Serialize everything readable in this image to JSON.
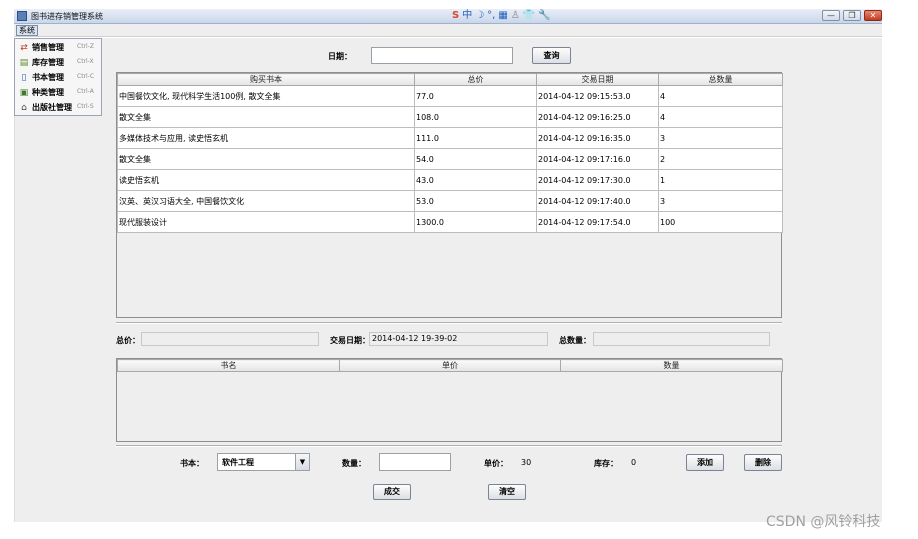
{
  "window": {
    "title": "图书进存销管理系统",
    "ime_icons": [
      "S",
      "中",
      "☽",
      "°,",
      "▦",
      "♙",
      "👕",
      "🔧"
    ],
    "min_label": "—",
    "max_label": "❐",
    "close_label": "✕"
  },
  "menubar": {
    "system": "系统"
  },
  "menu": {
    "items": [
      {
        "label": "销售管理",
        "shortcut": "Ctrl-Z",
        "icon": "sales-icon"
      },
      {
        "label": "库存管理",
        "shortcut": "Ctrl-X",
        "icon": "inventory-icon"
      },
      {
        "label": "书本管理",
        "shortcut": "Ctrl-C",
        "icon": "book-icon"
      },
      {
        "label": "种类管理",
        "shortcut": "Ctrl-A",
        "icon": "category-icon"
      },
      {
        "label": "出版社管理",
        "shortcut": "Ctrl-S",
        "icon": "publisher-icon"
      }
    ]
  },
  "search": {
    "date_label": "日期：",
    "date_value": "",
    "query_button": "查询"
  },
  "orders": {
    "columns": [
      "购买书本",
      "总价",
      "交易日期",
      "总数量"
    ],
    "rows": [
      [
        "中国餐饮文化, 现代科学生活100例, 散文全集",
        "77.0",
        "2014-04-12 09:15:53.0",
        "4"
      ],
      [
        "散文全集",
        "108.0",
        "2014-04-12 09:16:25.0",
        "4"
      ],
      [
        "多媒体技术与应用, 读史悟玄机",
        "111.0",
        "2014-04-12 09:16:35.0",
        "3"
      ],
      [
        "散文全集",
        "54.0",
        "2014-04-12 09:17:16.0",
        "2"
      ],
      [
        "读史悟玄机",
        "43.0",
        "2014-04-12 09:17:30.0",
        "1"
      ],
      [
        "汉英、英汉习语大全, 中国餐饮文化",
        "53.0",
        "2014-04-12 09:17:40.0",
        "3"
      ],
      [
        "现代服装设计",
        "1300.0",
        "2014-04-12 09:17:54.0",
        "100"
      ]
    ]
  },
  "summary": {
    "total_label": "总价：",
    "total_value": "",
    "date_label": "交易日期：",
    "date_value": "2014-04-12 19-39-02",
    "count_label": "总数量：",
    "count_value": ""
  },
  "items": {
    "columns": [
      "书名",
      "单价",
      "数量"
    ],
    "rows": []
  },
  "entry": {
    "book_label": "书本：",
    "book_value": "软件工程",
    "qty_label": "数量：",
    "qty_value": "",
    "price_label": "单价：",
    "price_value": "30",
    "stock_label": "库存：",
    "stock_value": "0",
    "add_button": "添加",
    "delete_button": "删除",
    "deal_button": "成交",
    "clear_button": "清空"
  },
  "watermark": "CSDN @风铃科技"
}
